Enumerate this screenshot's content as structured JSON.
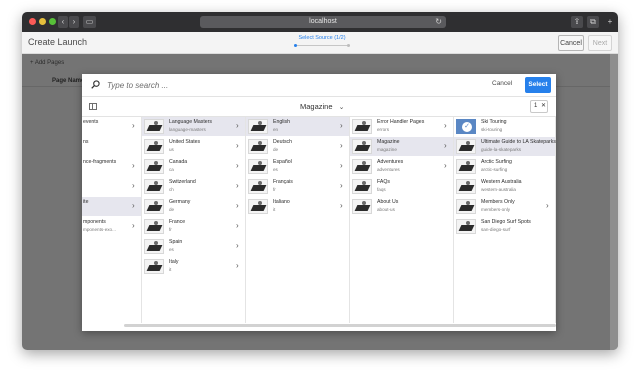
{
  "browser": {
    "url": "localhost",
    "back_glyph": "‹",
    "forward_glyph": "›",
    "reload_glyph": "↻",
    "share_glyph": "⇪",
    "tabs_glyph": "⧉",
    "newtab_glyph": "+"
  },
  "header": {
    "title": "Create Launch",
    "wizard_label": "Select Source (1/2)",
    "cancel_label": "Cancel",
    "next_label": "Next"
  },
  "background": {
    "add_pages_label": "+  Add Pages",
    "page_name_header": "Page Name"
  },
  "dialog": {
    "search_placeholder": "Type to search ...",
    "cancel_label": "Cancel",
    "select_label": "Select",
    "breadcrumb": "Magazine",
    "breadcrumb_chevron": "⌄",
    "selected_count": "1",
    "clear_glyph": "✕",
    "columns": [
      {
        "items": [
          {
            "title": "events",
            "sub": "",
            "has_children": true,
            "selected": false
          },
          {
            "title": "ns",
            "sub": "",
            "has_children": false,
            "selected": false
          },
          {
            "title": "nce-fragments",
            "sub": "",
            "has_children": true,
            "selected": false
          },
          {
            "title": "",
            "sub": "",
            "has_children": true,
            "selected": false
          },
          {
            "title": "ite",
            "sub": "",
            "has_children": true,
            "selected": true
          },
          {
            "title": "mponents",
            "sub": "mponents-exo...",
            "has_children": true,
            "selected": false
          }
        ]
      },
      {
        "items": [
          {
            "title": "Language Masters",
            "sub": "language-masters",
            "has_children": true,
            "selected": true
          },
          {
            "title": "United States",
            "sub": "us",
            "has_children": true,
            "selected": false
          },
          {
            "title": "Canada",
            "sub": "ca",
            "has_children": true,
            "selected": false
          },
          {
            "title": "Switzerland",
            "sub": "ch",
            "has_children": true,
            "selected": false
          },
          {
            "title": "Germany",
            "sub": "de",
            "has_children": true,
            "selected": false
          },
          {
            "title": "France",
            "sub": "fr",
            "has_children": true,
            "selected": false
          },
          {
            "title": "Spain",
            "sub": "es",
            "has_children": true,
            "selected": false
          },
          {
            "title": "Italy",
            "sub": "it",
            "has_children": true,
            "selected": false
          }
        ]
      },
      {
        "items": [
          {
            "title": "English",
            "sub": "en",
            "has_children": true,
            "selected": true
          },
          {
            "title": "Deutsch",
            "sub": "de",
            "has_children": true,
            "selected": false
          },
          {
            "title": "Español",
            "sub": "es",
            "has_children": true,
            "selected": false
          },
          {
            "title": "Français",
            "sub": "fr",
            "has_children": true,
            "selected": false
          },
          {
            "title": "Italiano",
            "sub": "it",
            "has_children": true,
            "selected": false
          }
        ]
      },
      {
        "items": [
          {
            "title": "Error Handler Pages",
            "sub": "errors",
            "has_children": true,
            "selected": false
          },
          {
            "title": "Magazine",
            "sub": "magazine",
            "has_children": true,
            "selected": true
          },
          {
            "title": "Adventures",
            "sub": "adventures",
            "has_children": true,
            "selected": false
          },
          {
            "title": "FAQs",
            "sub": "faqs",
            "has_children": false,
            "selected": false
          },
          {
            "title": "About Us",
            "sub": "about-us",
            "has_children": false,
            "selected": false
          }
        ]
      },
      {
        "items": [
          {
            "title": "Ski Touring",
            "sub": "ski-touring",
            "has_children": false,
            "selected": false,
            "checked": true
          },
          {
            "title": "Ultimate Guide to LA Skateparks",
            "sub": "guide-la-skateparks",
            "has_children": false,
            "selected": true
          },
          {
            "title": "Arctic Surfing",
            "sub": "arctic-surfing",
            "has_children": false,
            "selected": false
          },
          {
            "title": "Western Australia",
            "sub": "western-australia",
            "has_children": false,
            "selected": false
          },
          {
            "title": "Members Only",
            "sub": "members-only",
            "has_children": true,
            "selected": false
          },
          {
            "title": "San Diego Surf Spots",
            "sub": "san-diego-surf",
            "has_children": false,
            "selected": false
          }
        ]
      }
    ]
  },
  "colors": {
    "accent": "#2680eb",
    "selected_row": "#e6e6ee",
    "checked_thumb": "#5a87c4"
  }
}
